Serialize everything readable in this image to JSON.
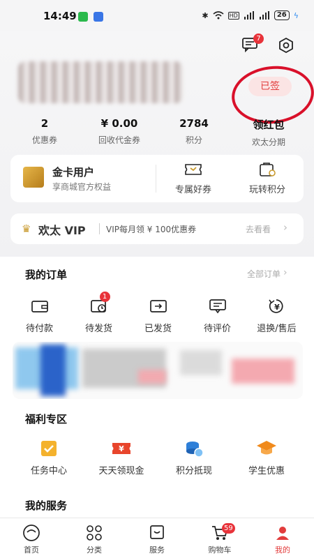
{
  "status_bar": {
    "time": "14:49",
    "battery": "26"
  },
  "header": {
    "messages_badge": "7",
    "sign_status": "已签"
  },
  "stats": [
    {
      "value": "2",
      "label": "优惠券"
    },
    {
      "value": "¥ 0.00",
      "label": "回收代金券"
    },
    {
      "value": "2784",
      "label": "积分"
    },
    {
      "value": "领红包",
      "label": "欢太分期"
    }
  ],
  "gold_card": {
    "title": "金卡用户",
    "subtitle": "享商城官方权益",
    "links": [
      {
        "label": "专属好券"
      },
      {
        "label": "玩转积分"
      }
    ]
  },
  "vip_bar": {
    "brand": "欢太 VIP",
    "text": "VIP每月领 ¥ 100优惠券",
    "link": "去看看"
  },
  "orders": {
    "title": "我的订单",
    "all_link": "全部订单",
    "items": [
      {
        "label": "待付款",
        "icon": "wallet-icon"
      },
      {
        "label": "待发货",
        "icon": "clock-box-icon",
        "badge": "1"
      },
      {
        "label": "已发货",
        "icon": "shipped-box-icon"
      },
      {
        "label": "待评价",
        "icon": "comment-icon"
      },
      {
        "label": "退换/售后",
        "icon": "yuan-refund-icon"
      }
    ]
  },
  "welfare": {
    "title": "福利专区",
    "items": [
      {
        "label": "任务中心",
        "icon": "task-check-icon",
        "color": "#f4b22d"
      },
      {
        "label": "天天领现金",
        "icon": "cash-ticket-icon",
        "color": "#e8452c"
      },
      {
        "label": "积分抵现",
        "icon": "coins-icon",
        "color": "#2e7fd8"
      },
      {
        "label": "学生优惠",
        "icon": "graduation-cap-icon",
        "color": "#f08a1c"
      }
    ]
  },
  "services": {
    "title": "我的服务"
  },
  "tabs": [
    {
      "label": "首页",
      "icon": "home-face-icon"
    },
    {
      "label": "分类",
      "icon": "category-grid-icon"
    },
    {
      "label": "服务",
      "icon": "service-icon"
    },
    {
      "label": "购物车",
      "icon": "cart-icon",
      "badge": "59"
    },
    {
      "label": "我的",
      "icon": "user-icon",
      "active": true
    }
  ],
  "colors": {
    "accent": "#e23c3c",
    "gold": "#c99a2e",
    "annotation_red": "#d9102a"
  }
}
